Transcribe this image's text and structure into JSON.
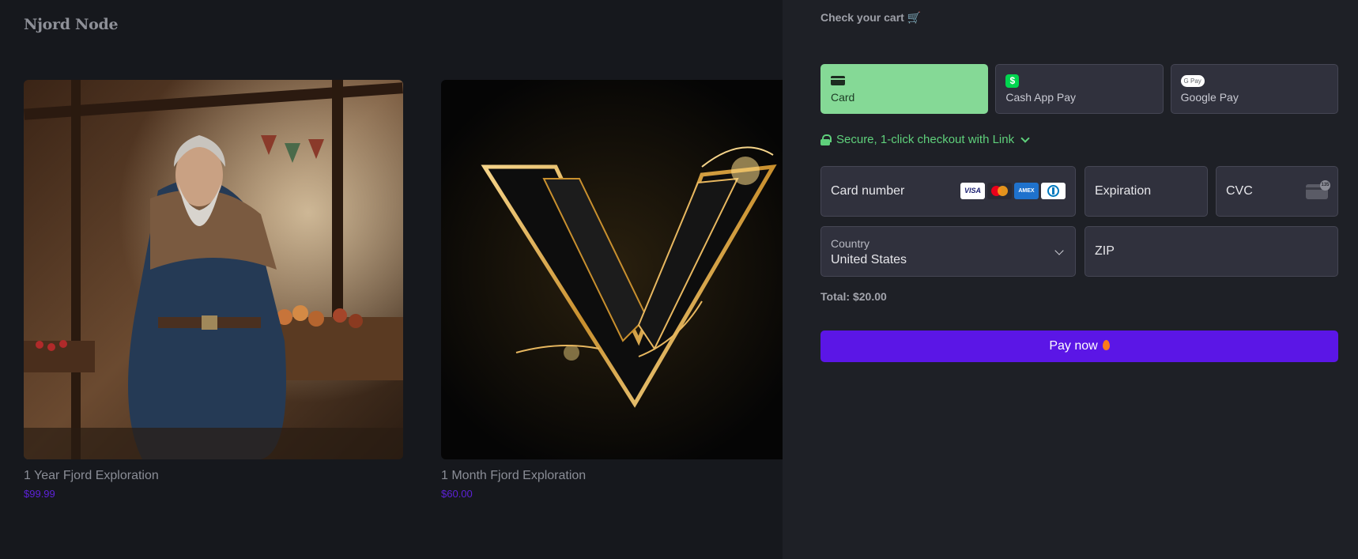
{
  "shop": {
    "brand": "Njord Node",
    "products": [
      {
        "name": "1 Year Fjord Exploration",
        "price": "$99.99"
      },
      {
        "name": "1 Month Fjord Exploration",
        "price": "$60.00"
      }
    ]
  },
  "checkout": {
    "title": "Check your cart",
    "title_emoji": "🛒",
    "payment_methods": [
      {
        "label": "Card",
        "icon": "credit-card-icon",
        "active": true
      },
      {
        "label": "Cash App Pay",
        "icon": "cash-app-icon",
        "active": false
      },
      {
        "label": "Google Pay",
        "icon": "google-pay-icon",
        "active": false
      }
    ],
    "gpay_badge": "G Pay",
    "cash_symbol": "$",
    "link_text": "Secure, 1-click checkout with Link",
    "card_number_placeholder": "Card number",
    "card_brands": [
      "VISA",
      "mastercard",
      "AMEX",
      "diners"
    ],
    "visa_text": "VISA",
    "amex_text": "AMEX",
    "expiration_placeholder": "Expiration",
    "cvc_placeholder": "CVC",
    "cvc_badge": "135",
    "country_label": "Country",
    "country_value": "United States",
    "zip_placeholder": "ZIP",
    "total": "Total: $20.00",
    "pay_label": "Pay now",
    "colors": {
      "accent_green": "#85d996",
      "link_green": "#5fd07b",
      "pay_purple": "#5b16e6",
      "price_purple": "#5d22d8"
    }
  }
}
